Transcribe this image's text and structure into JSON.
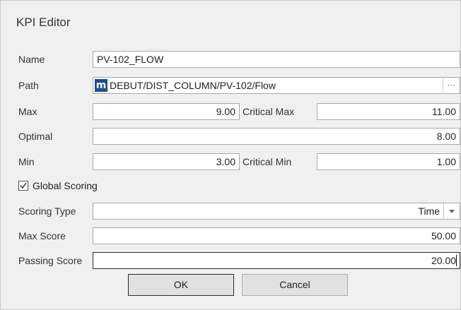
{
  "window": {
    "title": "KPI Editor"
  },
  "fields": {
    "name": {
      "label": "Name",
      "value": "PV-102_FLOW"
    },
    "path": {
      "label": "Path",
      "value": "DEBUT/DIST_COLUMN/PV-102/Flow",
      "browse": "···",
      "logo": "m"
    },
    "max": {
      "label": "Max",
      "value": "9.00"
    },
    "critical_max": {
      "label": "Critical Max",
      "value": "11.00"
    },
    "optimal": {
      "label": "Optimal",
      "value": "8.00"
    },
    "min": {
      "label": "Min",
      "value": "3.00"
    },
    "critical_min": {
      "label": "Critical Min",
      "value": "1.00"
    },
    "global_scoring": {
      "label": "Global Scoring",
      "checked": true
    },
    "scoring_type": {
      "label": "Scoring Type",
      "value": "Time"
    },
    "max_score": {
      "label": "Max Score",
      "value": "50.00"
    },
    "passing_score": {
      "label": "Passing Score",
      "value": "20.00"
    }
  },
  "buttons": {
    "ok": "OK",
    "cancel": "Cancel"
  }
}
